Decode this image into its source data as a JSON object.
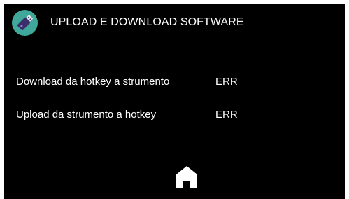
{
  "header": {
    "icon": "usb-stick-icon",
    "title": "UPLOAD E DOWNLOAD SOFTWARE"
  },
  "rows": [
    {
      "label": "Download da hotkey a strumento",
      "value": "ERR"
    },
    {
      "label": "Upload da strumento a hotkey",
      "value": "ERR"
    }
  ],
  "footer": {
    "home_icon": "home-icon"
  },
  "colors": {
    "background": "#000000",
    "text": "#ffffff",
    "icon_circle": "#3fa89a",
    "usb_body": "#3b2f6b"
  }
}
